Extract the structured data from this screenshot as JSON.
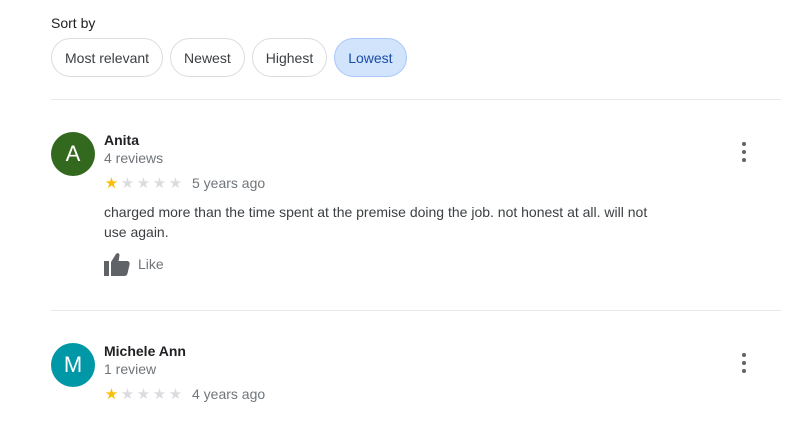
{
  "sort": {
    "label": "Sort by",
    "options": [
      "Most relevant",
      "Newest",
      "Highest",
      "Lowest"
    ],
    "selected": "Lowest"
  },
  "reviews": [
    {
      "initial": "A",
      "avatar_color": "#33691e",
      "name": "Anita",
      "review_count": "4 reviews",
      "rating": 1,
      "max_rating": 5,
      "age": "5 years ago",
      "text": "charged more than the time spent at the premise doing the job. not honest at all. will not use again.",
      "like_label": "Like"
    },
    {
      "initial": "M",
      "avatar_color": "#0097a7",
      "name": "Michele Ann",
      "review_count": "1 review",
      "rating": 1,
      "max_rating": 5,
      "age": "4 years ago"
    }
  ],
  "colors": {
    "star_filled": "#fbbc04",
    "star_empty": "#dadce0",
    "chip_selected_bg": "#d2e3fc"
  }
}
